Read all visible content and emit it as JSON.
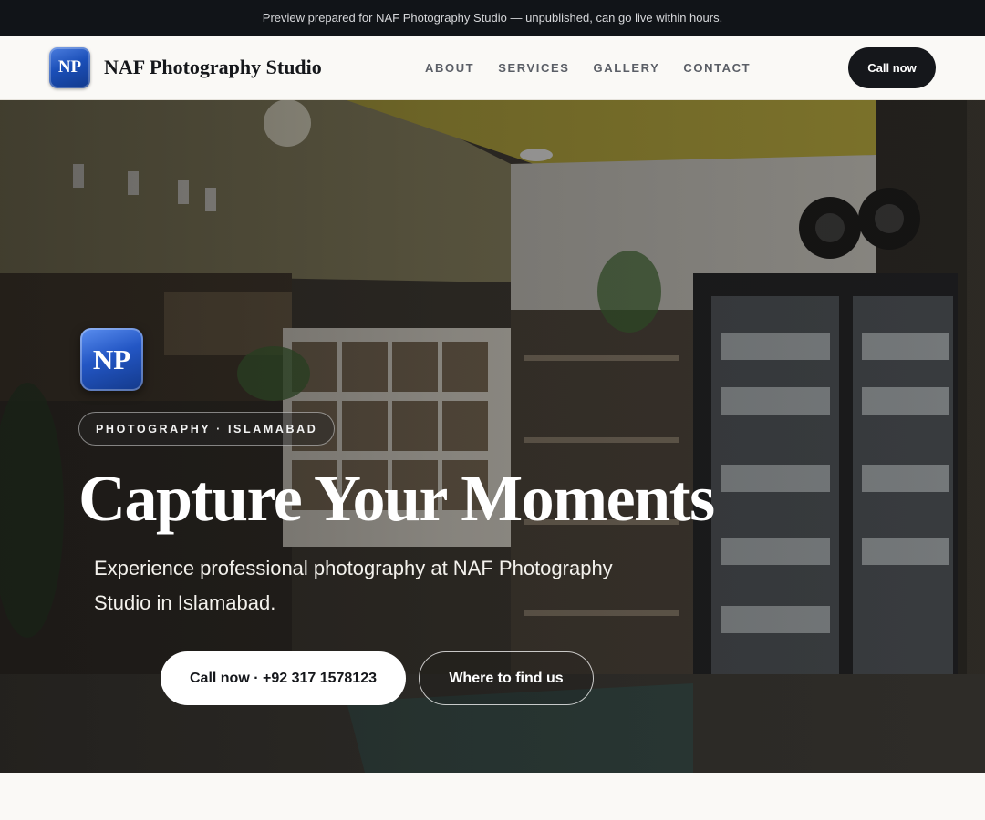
{
  "preview_bar": {
    "text": "Preview prepared for NAF Photography Studio — unpublished, can go live within hours."
  },
  "header": {
    "logo_initials": "NP",
    "brand_name": "NAF Photography Studio",
    "nav": [
      "ABOUT",
      "SERVICES",
      "GALLERY",
      "CONTACT"
    ],
    "cta_label": "Call now"
  },
  "hero": {
    "logo_initials": "NP",
    "tag": "PHOTOGRAPHY · ISLAMABAD",
    "title": "Capture Your Moments",
    "subtitle": "Experience professional photography at NAF Photography Studio in Islamabad.",
    "primary_button": "Call now · +92 317 1578123",
    "secondary_button": "Where to find us",
    "background_image": "studio-interior-photo"
  },
  "colors": {
    "dark": "#15171b",
    "logo_blue": "#1b4fb8",
    "page_bg": "#faf9f6"
  }
}
